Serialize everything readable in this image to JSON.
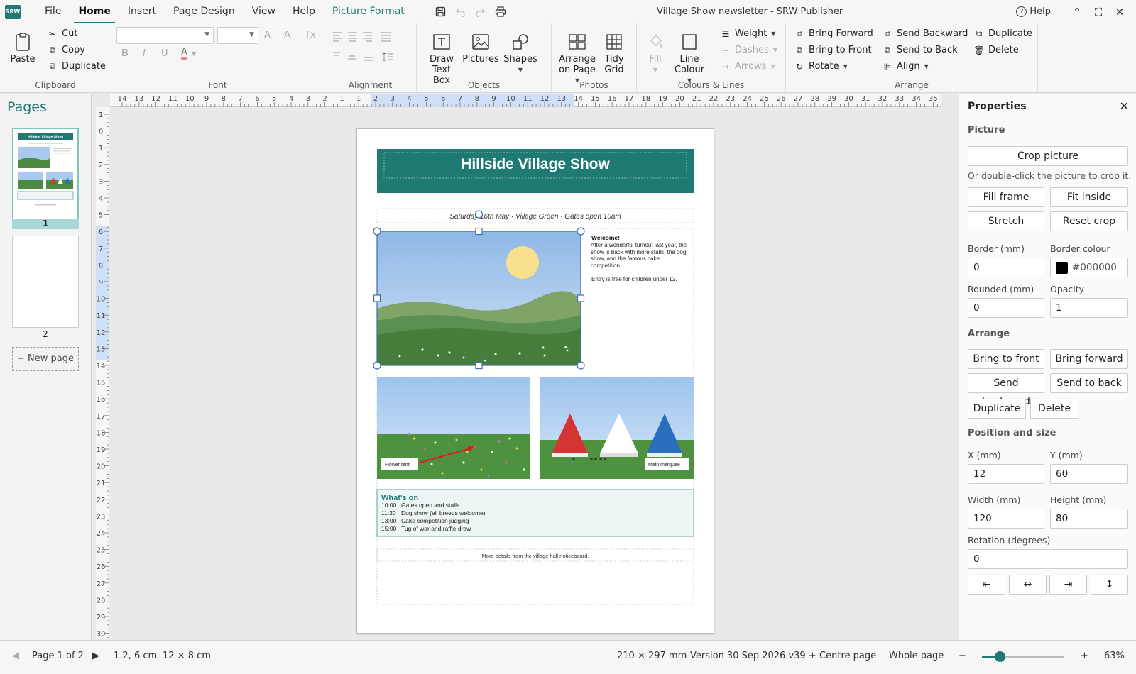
{
  "app": {
    "logo": "SRW",
    "title": "Village Show newsletter - SRW Publisher"
  },
  "menu": {
    "tabs": [
      "File",
      "Home",
      "Insert",
      "Page Design",
      "View",
      "Help",
      "Picture Format"
    ],
    "help_label": "Help"
  },
  "icons": {
    "save": "save-icon",
    "undo": "undo-icon",
    "redo": "redo-icon",
    "print": "print-icon",
    "help": "help-circle-icon",
    "minimize": "chevron-up-icon",
    "maximize": "expand-icon",
    "close": "close-icon"
  },
  "ribbon": {
    "clipboard": {
      "label": "Clipboard",
      "paste": "Paste",
      "cut": "Cut",
      "copy": "Copy",
      "duplicate": "Duplicate"
    },
    "font": {
      "label": "Font",
      "bold": "B",
      "italic": "I",
      "underline": "U",
      "color": "A",
      "grow": "A⁺",
      "shrink": "A⁻",
      "clear": "Tx"
    },
    "alignment": {
      "label": "Alignment"
    },
    "objects": {
      "label": "Objects",
      "draw_text_box_1": "Draw",
      "draw_text_box_2": "Text Box",
      "pictures": "Pictures",
      "shapes": "Shapes"
    },
    "photos": {
      "label": "Photos",
      "arrange_1": "Arrange",
      "arrange_2": "on Page",
      "tidy_1": "Tidy",
      "tidy_2": "Grid"
    },
    "colours": {
      "label": "Colours & Lines",
      "fill": "Fill",
      "line_colour_1": "Line",
      "line_colour_2": "Colour",
      "weight": "Weight",
      "dashes": "Dashes",
      "arrows": "Arrows"
    },
    "arrange": {
      "label": "Arrange",
      "bring_forward": "Bring Forward",
      "bring_to_front": "Bring to Front",
      "rotate": "Rotate",
      "send_backward": "Send Backward",
      "send_to_back": "Send to Back",
      "align": "Align",
      "duplicate": "Duplicate",
      "delete": "Delete"
    }
  },
  "pages_panel": {
    "title": "Pages",
    "pages": [
      "1",
      "2"
    ],
    "new_page": "+ New page",
    "thumb_title": "Hillside Village Show"
  },
  "ruler": {
    "h_ticks": [
      "14",
      "13",
      "12",
      "11",
      "10",
      "9",
      "8",
      "7",
      "6",
      "5",
      "4",
      "3",
      "2",
      "1",
      "1",
      "2",
      "3",
      "4",
      "5",
      "6",
      "7",
      "8",
      "9",
      "10",
      "11",
      "12",
      "13",
      "14",
      "15",
      "16",
      "17",
      "18",
      "19",
      "20",
      "21",
      "22",
      "23",
      "24",
      "25",
      "26",
      "27",
      "28",
      "29",
      "30",
      "31",
      "32",
      "33",
      "34",
      "35"
    ],
    "v_ticks": [
      "1",
      "0",
      "1",
      "2",
      "3",
      "4",
      "5",
      "6",
      "7",
      "8",
      "9",
      "10",
      "11",
      "12",
      "13",
      "14",
      "15",
      "16",
      "17",
      "18",
      "19",
      "20",
      "21",
      "22",
      "23",
      "24",
      "25",
      "26",
      "27",
      "28",
      "29",
      "30"
    ]
  },
  "document": {
    "title": "Hillside Village Show",
    "subtitle": "Saturday 16th May · Village Green · Gates open 10am",
    "welcome_heading": "Welcome!",
    "welcome_body": "After a wonderful turnout last year, the show is back with more stalls, the dog show, and the famous cake competition.",
    "welcome_note": "Entry is free for children under 12.",
    "caption_flower": "Flower tent",
    "caption_marquee": "Main marquee",
    "whats_on_title": "What's on",
    "schedule": [
      {
        "time": "10:00",
        "event": "Gates open and stalls"
      },
      {
        "time": "11:30",
        "event": "Dog show (all breeds welcome)"
      },
      {
        "time": "13:00",
        "event": "Cake competition judging"
      },
      {
        "time": "15:00",
        "event": "Tug of war and raffle draw"
      }
    ],
    "footer": "More details from the village hall noticeboard."
  },
  "properties": {
    "title": "Properties",
    "picture_section": "Picture",
    "crop_picture": "Crop picture",
    "crop_hint": "Or double-click the picture to crop it.",
    "fill_frame": "Fill frame",
    "fit_inside": "Fit inside",
    "stretch": "Stretch",
    "reset_crop": "Reset crop",
    "border_label": "Border (mm)",
    "border_value": "0",
    "border_colour_label": "Border colour",
    "border_colour_value": "#000000",
    "rounded_label": "Rounded (mm)",
    "rounded_value": "0",
    "opacity_label": "Opacity",
    "opacity_value": "1",
    "arrange_section": "Arrange",
    "bring_to_front": "Bring to front",
    "bring_forward": "Bring forward",
    "send_backward": "Send backward",
    "send_to_back": "Send to back",
    "duplicate": "Duplicate",
    "delete": "Delete",
    "position_section": "Position and size",
    "x_label": "X (mm)",
    "x_value": "12",
    "y_label": "Y (mm)",
    "y_value": "60",
    "width_label": "Width (mm)",
    "width_value": "120",
    "height_label": "Height (mm)",
    "height_value": "80",
    "rotation_label": "Rotation (degrees)",
    "rotation_value": "0",
    "align_buttons": [
      "⇤",
      "↔",
      "⇥",
      "↕"
    ]
  },
  "status": {
    "page": "Page 1 of 2",
    "position": "1.2, 6 cm",
    "size": "12 × 8 cm",
    "paper": "210 × 297 mm",
    "version": "Version 30 Sep 2026 v39",
    "centre_page": "+ Centre page",
    "whole_page": "Whole page",
    "zoom_minus": "−",
    "zoom_plus": "+",
    "zoom": "63%",
    "zoom_fraction": 0.22
  },
  "colors": {
    "accent": "#1f7a73",
    "selection": "#3b6db3"
  }
}
